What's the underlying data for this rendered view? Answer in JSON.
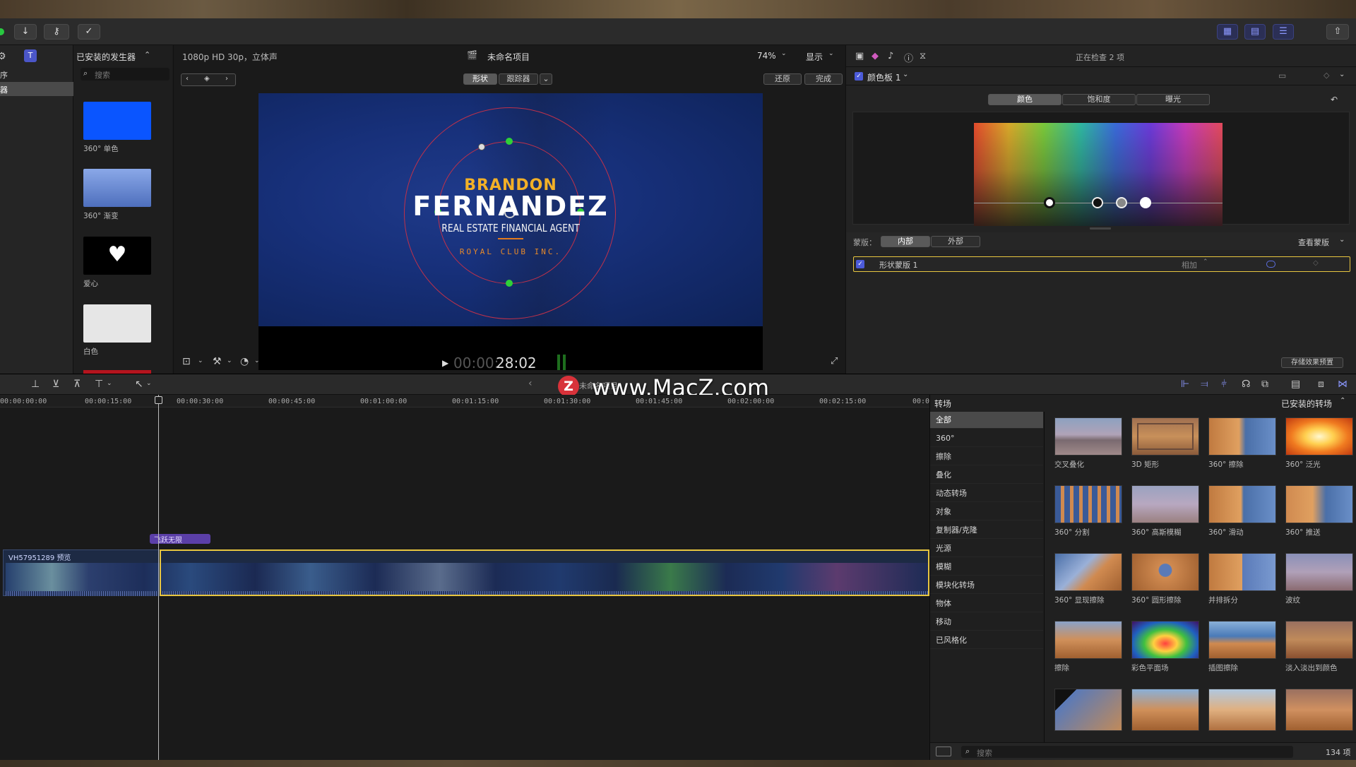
{
  "toolbar": {
    "import_icon": "download-arrow-icon",
    "keyword_icon": "key-icon",
    "analysis_icon": "checkmark-circle-icon"
  },
  "sidebar": {
    "items": [
      "序",
      "器"
    ]
  },
  "generators": {
    "title": "已安装的发生器",
    "search_placeholder": "搜索",
    "items": [
      {
        "label": "360° 单色",
        "color": "#0a55ff"
      },
      {
        "label": "360° 渐变",
        "color": "#6e8fd6"
      },
      {
        "label": "爱心",
        "color": "#000000"
      },
      {
        "label": "白色",
        "color": "#e6e6e6"
      }
    ]
  },
  "viewer": {
    "format": "1080p HD 30p，立体声",
    "project": "未命名项目",
    "zoom": "74%",
    "display_menu": "显示",
    "mode_shape": "形状",
    "mode_tracker": "跟踪器",
    "reset": "还原",
    "done": "完成",
    "title_line1": "BRANDON",
    "title_line2": "FERNANDEZ",
    "title_line3": "REAL ESTATE FINANCIAL AGENT",
    "title_line4": "ROYAL CLUB INC.",
    "timecode_dim": "00:00:",
    "timecode": "28:02"
  },
  "inspector": {
    "header": "正在检查 2 项",
    "board_label": "颜色板 1",
    "tabs": [
      "颜色",
      "饱和度",
      "曝光"
    ],
    "mask_label": "蒙版：",
    "mask_inner": "内部",
    "mask_outer": "外部",
    "view_mask": "查看蒙版",
    "shape_mask": "形状蒙版 1",
    "blend_mode": "相加",
    "save_preset": "存储效果预置"
  },
  "timeline": {
    "watermark": "www.MacZ.com",
    "watermark_logo": "Z",
    "ruler": [
      "00:00:00:00",
      "00:00:15:00",
      "00:00:30:00",
      "00:00:45:00",
      "00:01:00:00",
      "00:01:15:00",
      "00:01:30:00",
      "00:01:45:00",
      "00:02:00:00",
      "00:02:15:00",
      "00:0"
    ],
    "clip_name": "VH57951289 预览",
    "title_clip": "飞跃无限",
    "partial_header": "未命名项目"
  },
  "transitions": {
    "heading": "转场",
    "installed": "已安装的转场",
    "categories": [
      "全部",
      "360°",
      "擦除",
      "叠化",
      "动态转场",
      "对象",
      "复制器/克隆",
      "光源",
      "模糊",
      "模块化转场",
      "物体",
      "移动",
      "已风格化"
    ],
    "items": [
      "交叉叠化",
      "3D 矩形",
      "360° 擦除",
      "360° 泛光",
      "360° 分割",
      "360° 高斯模糊",
      "360° 滑动",
      "360° 推送",
      "360° 显现擦除",
      "360° 圆形擦除",
      "并排拆分",
      "波纹",
      "擦除",
      "彩色平面场",
      "插图擦除",
      "淡入淡出到颜色"
    ],
    "search_placeholder": "搜索",
    "count": "134 项"
  }
}
